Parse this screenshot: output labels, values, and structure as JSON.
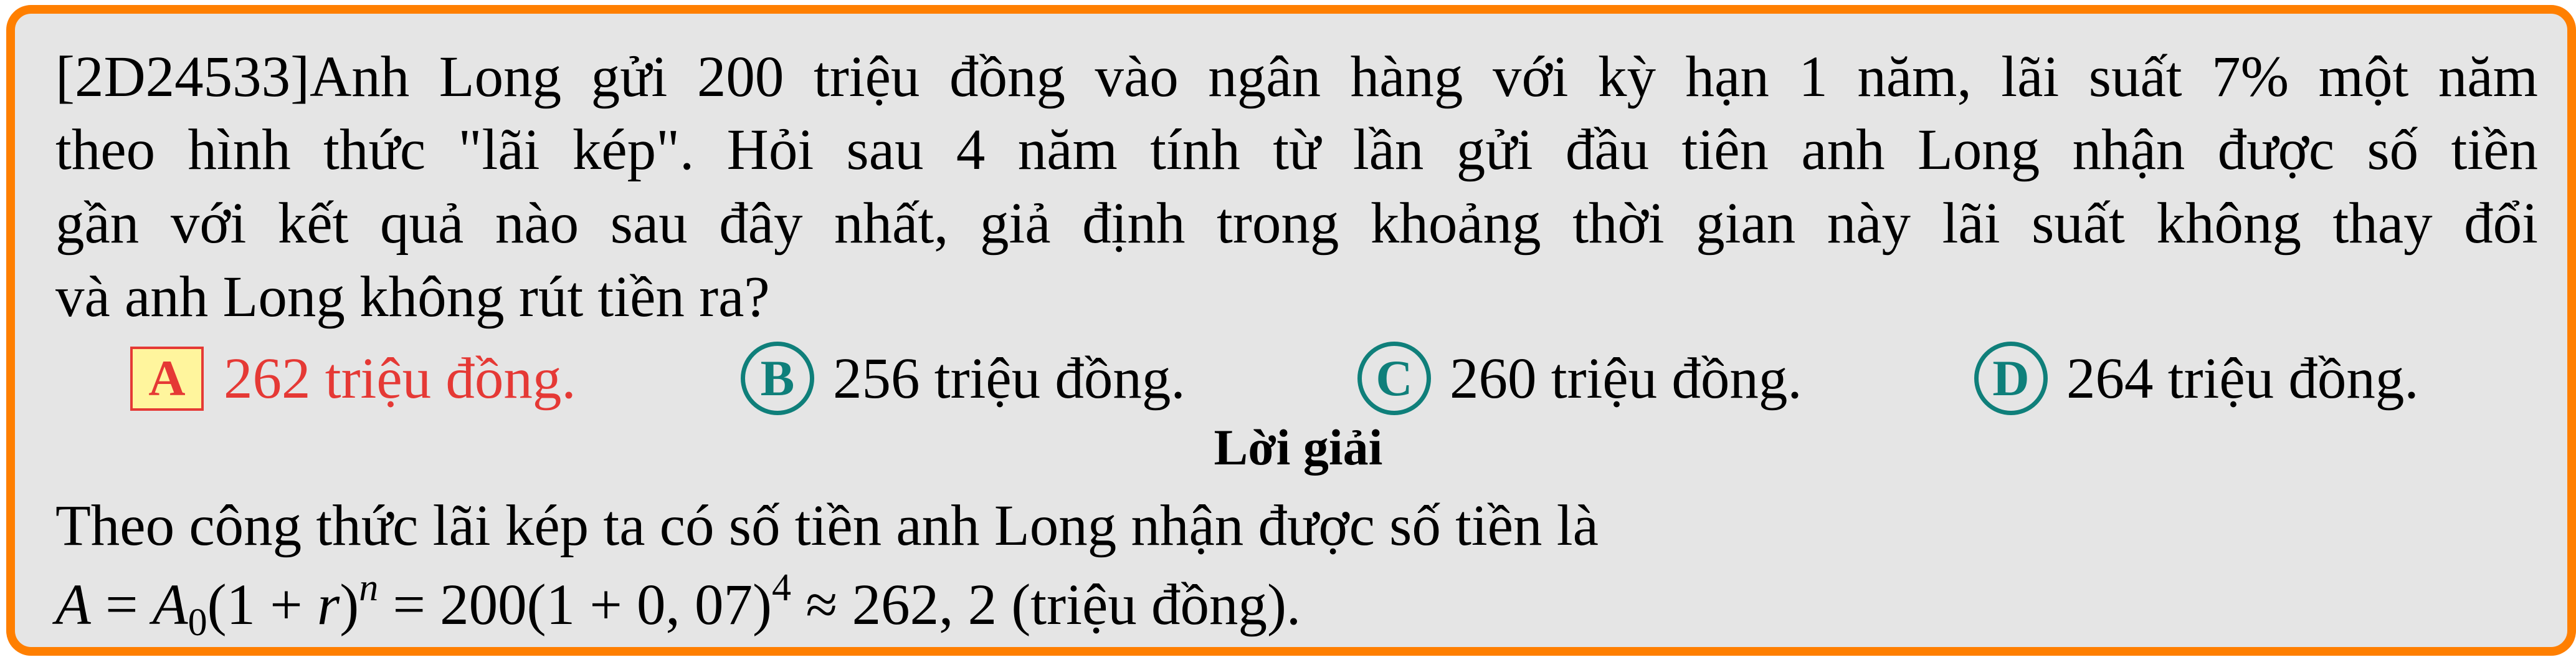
{
  "question": {
    "lines": [
      "[2D24533]Anh Long gửi 200 triệu đồng vào ngân hàng với kỳ hạn 1 năm, lãi suất 7% một năm",
      "theo hình thức \"lãi kép\". Hỏi sau 4 năm tính từ lần gửi đầu tiên anh Long nhận được số tiền",
      "gần với kết quả nào sau đây nhất, giả định trong khoảng thời gian này lãi suất không thay đổi",
      "và anh Long không rút tiền ra?"
    ]
  },
  "options": [
    {
      "letter": "A",
      "text": "262 triệu đồng.",
      "correct": true
    },
    {
      "letter": "B",
      "text": "256 triệu đồng.",
      "correct": false
    },
    {
      "letter": "C",
      "text": "260 triệu đồng.",
      "correct": false
    },
    {
      "letter": "D",
      "text": "264 triệu đồng.",
      "correct": false
    }
  ],
  "solution": {
    "title": "Lời giải",
    "line1": "Theo công thức lãi kép ta có số tiền anh Long nhận được số tiền là",
    "formula": {
      "lhs_var": "A",
      "base_var": "A",
      "base_sub": "0",
      "paren_open": "(1 + ",
      "rate_var": "r",
      "paren_close": ")",
      "exp_var": "n",
      "equals1": " = 200(1 + 0, 07)",
      "exp_num": "4",
      "approx": " ≈ 262, 2 (triệu đồng)."
    }
  },
  "colors": {
    "frame_border": "#ff7f00",
    "background": "#e5e5e5",
    "correct": "#e53935",
    "correct_fill": "#fff59d",
    "option_circle": "#0f7f7a"
  }
}
